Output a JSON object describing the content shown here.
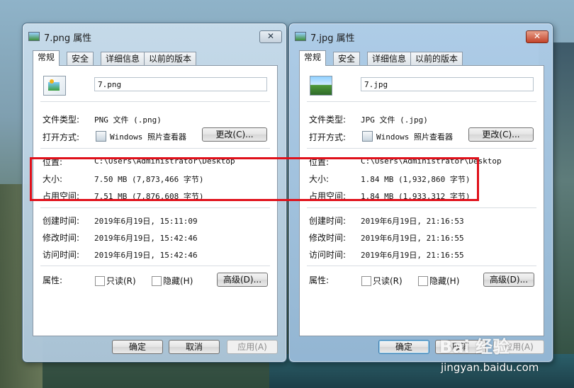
{
  "dialogs": [
    {
      "title": "7.png 属性",
      "close": "✕",
      "tabs": [
        "常规",
        "安全",
        "详细信息",
        "以前的版本"
      ],
      "filename": "7.png",
      "labels": {
        "type": "文件类型:",
        "open_with": "打开方式:",
        "location": "位置:",
        "size": "大小:",
        "size_on_disk": "占用空间:",
        "created": "创建时间:",
        "modified": "修改时间:",
        "accessed": "访问时间:",
        "attributes": "属性:"
      },
      "type": "PNG 文件 (.png)",
      "open_with": "Windows 照片查看器",
      "change_button": "更改(C)...",
      "location": "C:\\Users\\Administrator\\Desktop",
      "size": "7.50 MB (7,873,466 字节)",
      "size_on_disk": "7.51 MB (7,876,608 字节)",
      "created": "2019年6月19日, 15:11:09",
      "modified": "2019年6月19日, 15:42:46",
      "accessed": "2019年6月19日, 15:42:46",
      "readonly": "只读(R)",
      "hidden": "隐藏(H)",
      "advanced_button": "高级(D)...",
      "ok": "确定",
      "cancel": "取消",
      "apply": "应用(A)"
    },
    {
      "title": "7.jpg 属性",
      "close": "✕",
      "tabs": [
        "常规",
        "安全",
        "详细信息",
        "以前的版本"
      ],
      "filename": "7.jpg",
      "labels": {
        "type": "文件类型:",
        "open_with": "打开方式:",
        "location": "位置:",
        "size": "大小:",
        "size_on_disk": "占用空间:",
        "created": "创建时间:",
        "modified": "修改时间:",
        "accessed": "访问时间:",
        "attributes": "属性:"
      },
      "type": "JPG 文件 (.jpg)",
      "open_with": "Windows 照片查看器",
      "change_button": "更改(C)...",
      "location": "C:\\Users\\Administrator\\Desktop",
      "size": "1.84 MB (1,932,860 字节)",
      "size_on_disk": "1.84 MB (1,933,312 字节)",
      "created": "2019年6月19日, 21:16:53",
      "modified": "2019年6月19日, 21:16:55",
      "accessed": "2019年6月19日, 21:16:55",
      "readonly": "只读(R)",
      "hidden": "隐藏(H)",
      "advanced_button": "高级(D)...",
      "ok": "确定",
      "cancel": "取消",
      "apply": "应用(A)"
    }
  ],
  "watermark": {
    "brand": "Bai 经验",
    "url": "jingyan.baidu.com"
  },
  "colors": {
    "highlight": "#e0101a"
  }
}
